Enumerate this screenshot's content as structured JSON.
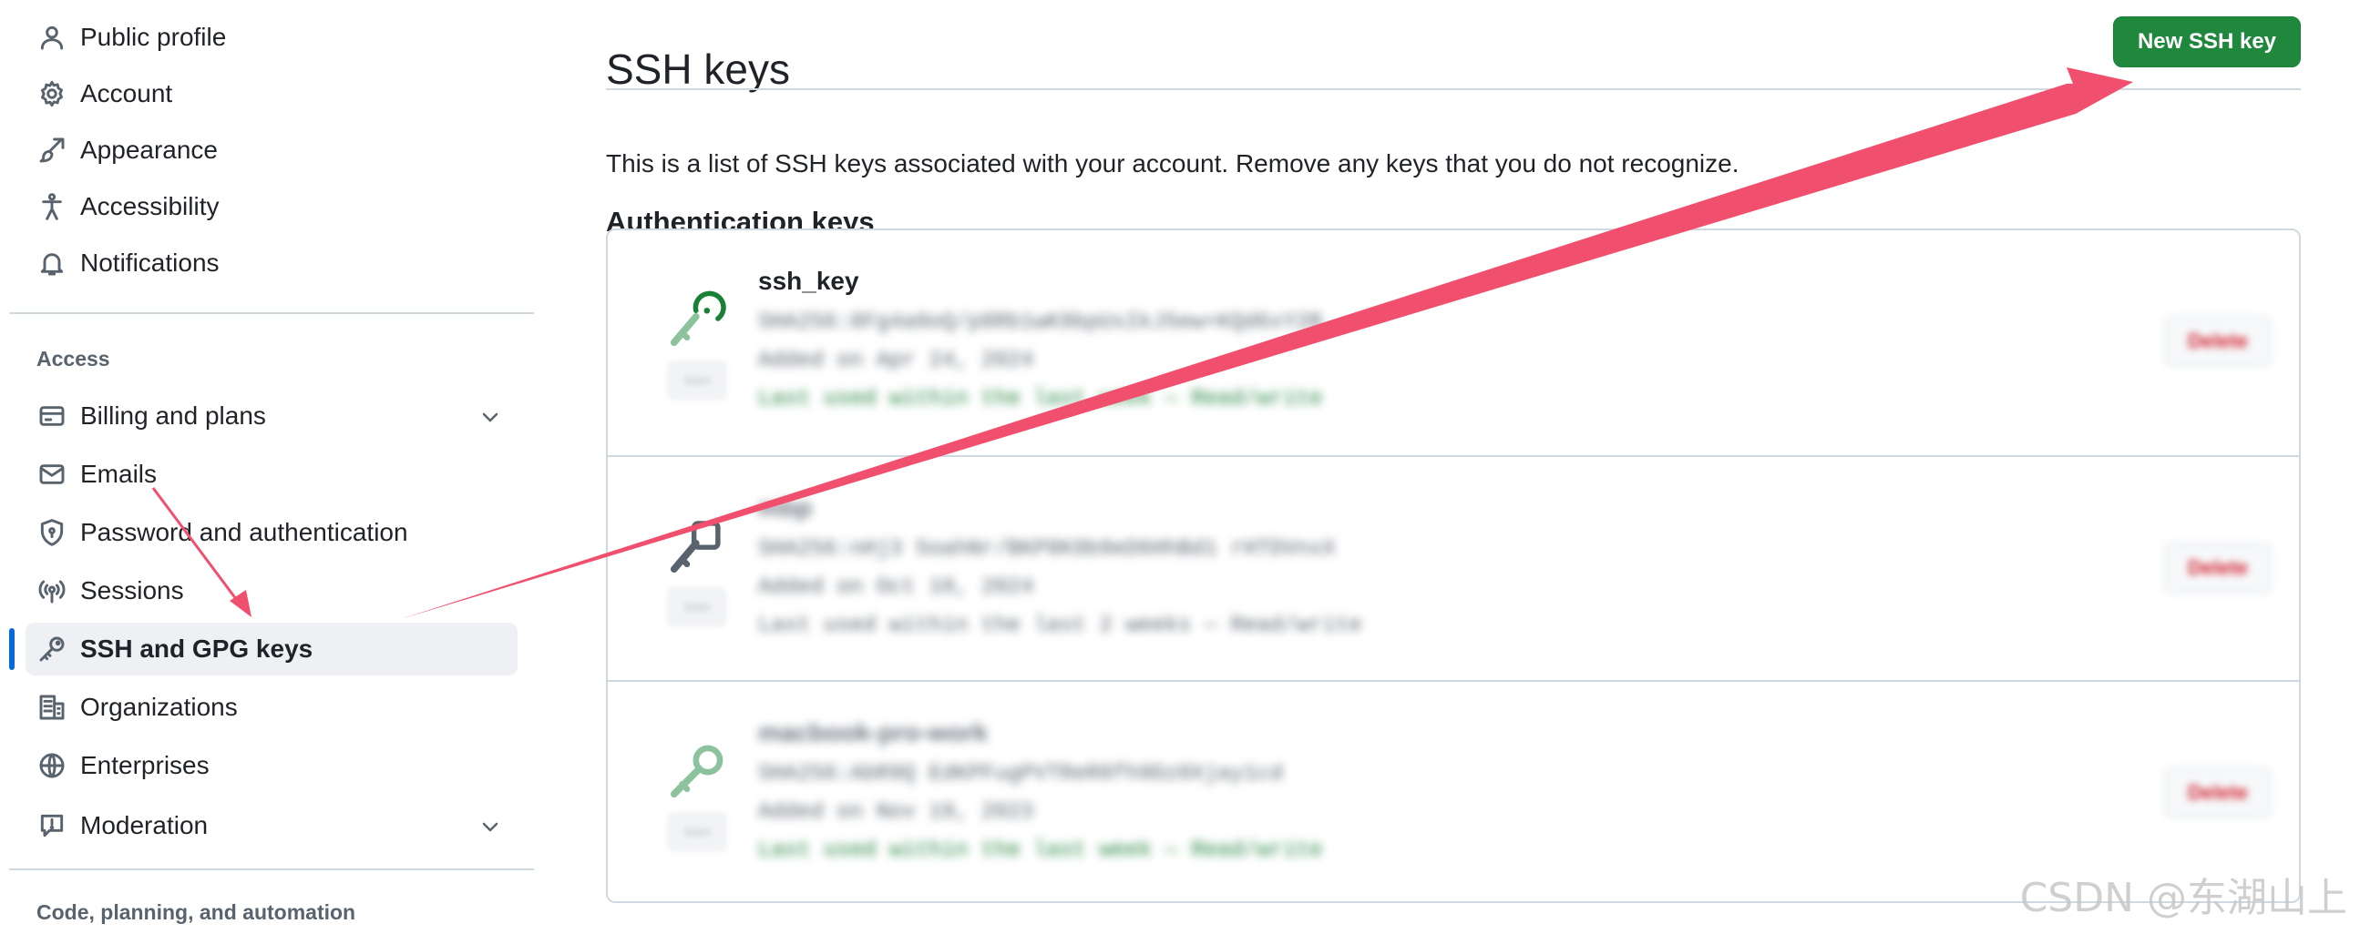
{
  "sidebar": {
    "top_items": [
      {
        "label": "Public profile",
        "icon": "person-icon"
      },
      {
        "label": "Account",
        "icon": "gear-icon"
      },
      {
        "label": "Appearance",
        "icon": "paintbrush-icon"
      },
      {
        "label": "Accessibility",
        "icon": "accessibility-icon"
      },
      {
        "label": "Notifications",
        "icon": "bell-icon"
      }
    ],
    "access_title": "Access",
    "access_items": [
      {
        "label": "Billing and plans",
        "icon": "credit-card-icon",
        "expandable": true
      },
      {
        "label": "Emails",
        "icon": "mail-icon"
      },
      {
        "label": "Password and authentication",
        "icon": "shield-lock-icon"
      },
      {
        "label": "Sessions",
        "icon": "broadcast-icon"
      },
      {
        "label": "SSH and GPG keys",
        "icon": "key-icon",
        "active": true
      },
      {
        "label": "Organizations",
        "icon": "organization-icon"
      },
      {
        "label": "Enterprises",
        "icon": "globe-icon"
      },
      {
        "label": "Moderation",
        "icon": "report-icon",
        "expandable": true
      }
    ],
    "code_title": "Code, planning, and automation"
  },
  "main": {
    "title": "SSH keys",
    "new_key_button": "New SSH key",
    "intro": "This is a list of SSH keys associated with your account. Remove any keys that you do not recognize.",
    "section_title": "Authentication keys",
    "keys": [
      {
        "title": "ssh_key",
        "title_obscured": false,
        "icon_color": "#1a7f37"
      },
      {
        "title": "",
        "title_obscured": true,
        "icon_color": "#59636e"
      },
      {
        "title": "",
        "title_obscured": true,
        "icon_color": "#1a7f37"
      }
    ]
  },
  "watermark": "CSDN @东湖山上",
  "colors": {
    "accent": "#0969da",
    "primary_button": "#1f883d",
    "annotation_arrow": "#f0506e",
    "danger": "#d1242f"
  }
}
